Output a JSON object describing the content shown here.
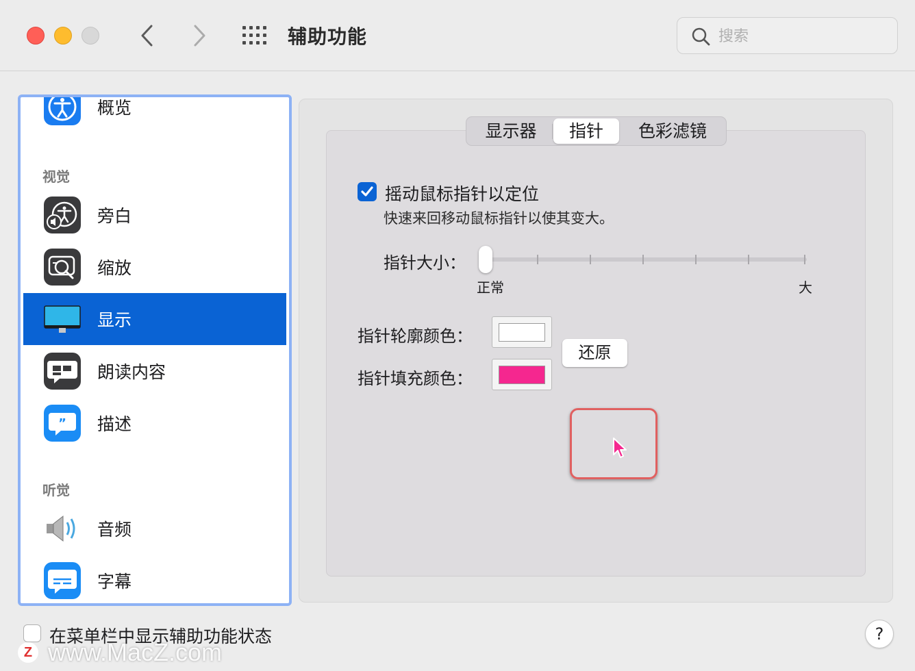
{
  "window": {
    "title": "辅助功能",
    "search_placeholder": "搜索"
  },
  "sidebar": {
    "sections": [
      {
        "label": "视觉"
      },
      {
        "label": "听觉"
      }
    ],
    "items": [
      {
        "label": "概览",
        "icon": "accessibility-icon"
      },
      {
        "label": "旁白",
        "icon": "voiceover-icon"
      },
      {
        "label": "缩放",
        "icon": "zoom-icon"
      },
      {
        "label": "显示",
        "icon": "display-icon",
        "selected": true
      },
      {
        "label": "朗读内容",
        "icon": "spoken-content-icon"
      },
      {
        "label": "描述",
        "icon": "descriptions-icon"
      },
      {
        "label": "音频",
        "icon": "audio-speaker-icon"
      },
      {
        "label": "字幕",
        "icon": "captions-icon"
      }
    ]
  },
  "tabs": [
    {
      "label": "显示器"
    },
    {
      "label": "指针",
      "active": true
    },
    {
      "label": "色彩滤镜"
    }
  ],
  "pointer": {
    "shake_label": "摇动鼠标指针以定位",
    "shake_checked": true,
    "shake_description": "快速来回移动鼠标指针以使其变大。",
    "size_label": "指针大小：",
    "size_min_label": "正常",
    "size_max_label": "大",
    "size_value": 0,
    "outline_label": "指针轮廓颜色：",
    "outline_color": "#ffffff",
    "fill_label": "指针填充颜色：",
    "fill_color": "#f5278f",
    "reset_label": "还原"
  },
  "bottom": {
    "menubar_label": "在菜单栏中显示辅助功能状态",
    "menubar_checked": false,
    "help_label": "?"
  },
  "watermark": {
    "logo": "Z",
    "text": "www.MacZ.com"
  }
}
